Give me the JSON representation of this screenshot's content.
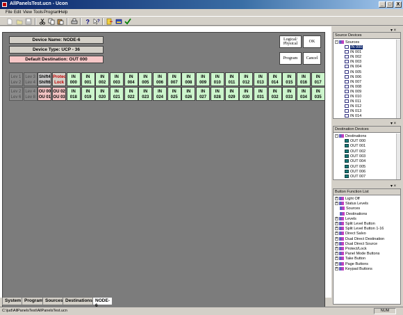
{
  "window": {
    "title": "AllPanelsTest.ucn - Ucon",
    "minimize": "_",
    "maximize": "□",
    "close": "X"
  },
  "menu": [
    "File",
    "Edit",
    "View",
    "Tools",
    "Program",
    "Help"
  ],
  "toolbar": {
    "icons": [
      "new-icon",
      "open-icon",
      "save-icon",
      "cut-icon",
      "copy-icon",
      "paste-icon",
      "print-icon",
      "help-icon",
      "context-help-icon",
      "export-icon",
      "import-icon",
      "check-icon"
    ]
  },
  "panel": {
    "device_name": "Device Name: NODE-6",
    "device_type": "Device Type: UCP - 36",
    "default_destination": "Default Destination: OUT  000",
    "buttons": {
      "logical_physical_1": "Logical/",
      "logical_physical_2": "Physical",
      "ok": "OK",
      "program": "Program",
      "cancel": "Cancel"
    },
    "row1": [
      {
        "l1": "Lev 1",
        "l2": "Lev 2",
        "style": "grey"
      },
      {
        "l1": "Lev 3",
        "l2": "Lev 4",
        "style": "grey"
      },
      {
        "l1": "Shift4",
        "l2": "Shift6",
        "style": "shift"
      },
      {
        "l1": "Protec",
        "l2": "Lock",
        "style": "red"
      },
      {
        "l1": "IN",
        "l2": "000",
        "style": "green"
      },
      {
        "l1": "IN",
        "l2": "001",
        "style": "green"
      },
      {
        "l1": "IN",
        "l2": "002",
        "style": "green"
      },
      {
        "l1": "IN",
        "l2": "003",
        "style": "green"
      },
      {
        "l1": "IN",
        "l2": "004",
        "style": "green"
      },
      {
        "l1": "IN",
        "l2": "005",
        "style": "green"
      },
      {
        "l1": "IN",
        "l2": "006",
        "style": "green"
      },
      {
        "l1": "IN",
        "l2": "007",
        "style": "green"
      },
      {
        "l1": "IN",
        "l2": "008",
        "style": "green"
      },
      {
        "l1": "IN",
        "l2": "009",
        "style": "green"
      },
      {
        "l1": "IN",
        "l2": "010",
        "style": "green"
      },
      {
        "l1": "IN",
        "l2": "011",
        "style": "green"
      },
      {
        "l1": "IN",
        "l2": "012",
        "style": "green"
      },
      {
        "l1": "IN",
        "l2": "013",
        "style": "green"
      },
      {
        "l1": "IN",
        "l2": "014",
        "style": "green"
      },
      {
        "l1": "IN",
        "l2": "015",
        "style": "green"
      },
      {
        "l1": "IN",
        "l2": "016",
        "style": "green"
      },
      {
        "l1": "IN",
        "l2": "017",
        "style": "green"
      }
    ],
    "row2": [
      {
        "l1": "Lev 2",
        "l2": "Lev 6",
        "style": "grey"
      },
      {
        "l1": "Lev 4",
        "l2": "Lev 8",
        "style": "grey"
      },
      {
        "l1": "OU 00",
        "l2": "OU 01",
        "style": "pink"
      },
      {
        "l1": "OU 02",
        "l2": "OU 03",
        "style": "pink"
      },
      {
        "l1": "IN",
        "l2": "018",
        "style": "green"
      },
      {
        "l1": "IN",
        "l2": "019",
        "style": "green"
      },
      {
        "l1": "IN",
        "l2": "020",
        "style": "green"
      },
      {
        "l1": "IN",
        "l2": "021",
        "style": "green"
      },
      {
        "l1": "IN",
        "l2": "022",
        "style": "green"
      },
      {
        "l1": "IN",
        "l2": "023",
        "style": "green"
      },
      {
        "l1": "IN",
        "l2": "024",
        "style": "green"
      },
      {
        "l1": "IN",
        "l2": "025",
        "style": "green"
      },
      {
        "l1": "IN",
        "l2": "026",
        "style": "green"
      },
      {
        "l1": "IN",
        "l2": "027",
        "style": "green"
      },
      {
        "l1": "IN",
        "l2": "028",
        "style": "green"
      },
      {
        "l1": "IN",
        "l2": "029",
        "style": "green"
      },
      {
        "l1": "IN",
        "l2": "030",
        "style": "green"
      },
      {
        "l1": "IN",
        "l2": "031",
        "style": "green"
      },
      {
        "l1": "IN",
        "l2": "032",
        "style": "green"
      },
      {
        "l1": "IN",
        "l2": "033",
        "style": "green"
      },
      {
        "l1": "IN",
        "l2": "034",
        "style": "green"
      },
      {
        "l1": "IN",
        "l2": "035",
        "style": "green"
      }
    ]
  },
  "tabs": [
    "System",
    "Program",
    "Sources",
    "Destinations",
    "NODE-6"
  ],
  "active_tab": "NODE-6",
  "status": {
    "path": "C:\\jud\\AllPanelsTest\\AllPanelsTest.ucn",
    "num": "NUM"
  },
  "source_devices": {
    "title": "Source Devices",
    "root": "Sources",
    "items": [
      "IN  000",
      "IN  001",
      "IN  002",
      "IN  003",
      "IN  004",
      "IN  005",
      "IN  006",
      "IN  007",
      "IN  008",
      "IN  009",
      "IN  010",
      "IN  011",
      "IN  012",
      "IN  013",
      "IN  014"
    ],
    "selected": "IN  000"
  },
  "destination_devices": {
    "title": "Destination Devices",
    "root": "Destinations",
    "items": [
      "OUT  000",
      "OUT  001",
      "OUT  002",
      "OUT  003",
      "OUT  004",
      "OUT  005",
      "OUT  006",
      "OUT  007"
    ]
  },
  "button_function_list": {
    "title": "Button Function List",
    "items": [
      {
        "label": "Light Off",
        "expand": true
      },
      {
        "label": "Status Levels",
        "expand": true
      },
      {
        "label": "Sources",
        "expand": false
      },
      {
        "label": "Destinations",
        "expand": false
      },
      {
        "label": "Levels",
        "expand": true
      },
      {
        "label": "Split Level Button",
        "expand": true
      },
      {
        "label": "Split Level Button 1-16",
        "expand": true
      },
      {
        "label": "Direct Salvo",
        "expand": true
      },
      {
        "label": "Dual Direct Destination",
        "expand": true
      },
      {
        "label": "Dual Direct Source",
        "expand": true
      },
      {
        "label": "Protect/Lock",
        "expand": true
      },
      {
        "label": "Panel Mode Buttons",
        "expand": true
      },
      {
        "label": "Take Button",
        "expand": true
      },
      {
        "label": "Page Buttons",
        "expand": true
      },
      {
        "label": "Keypad Buttons",
        "expand": true
      }
    ]
  }
}
